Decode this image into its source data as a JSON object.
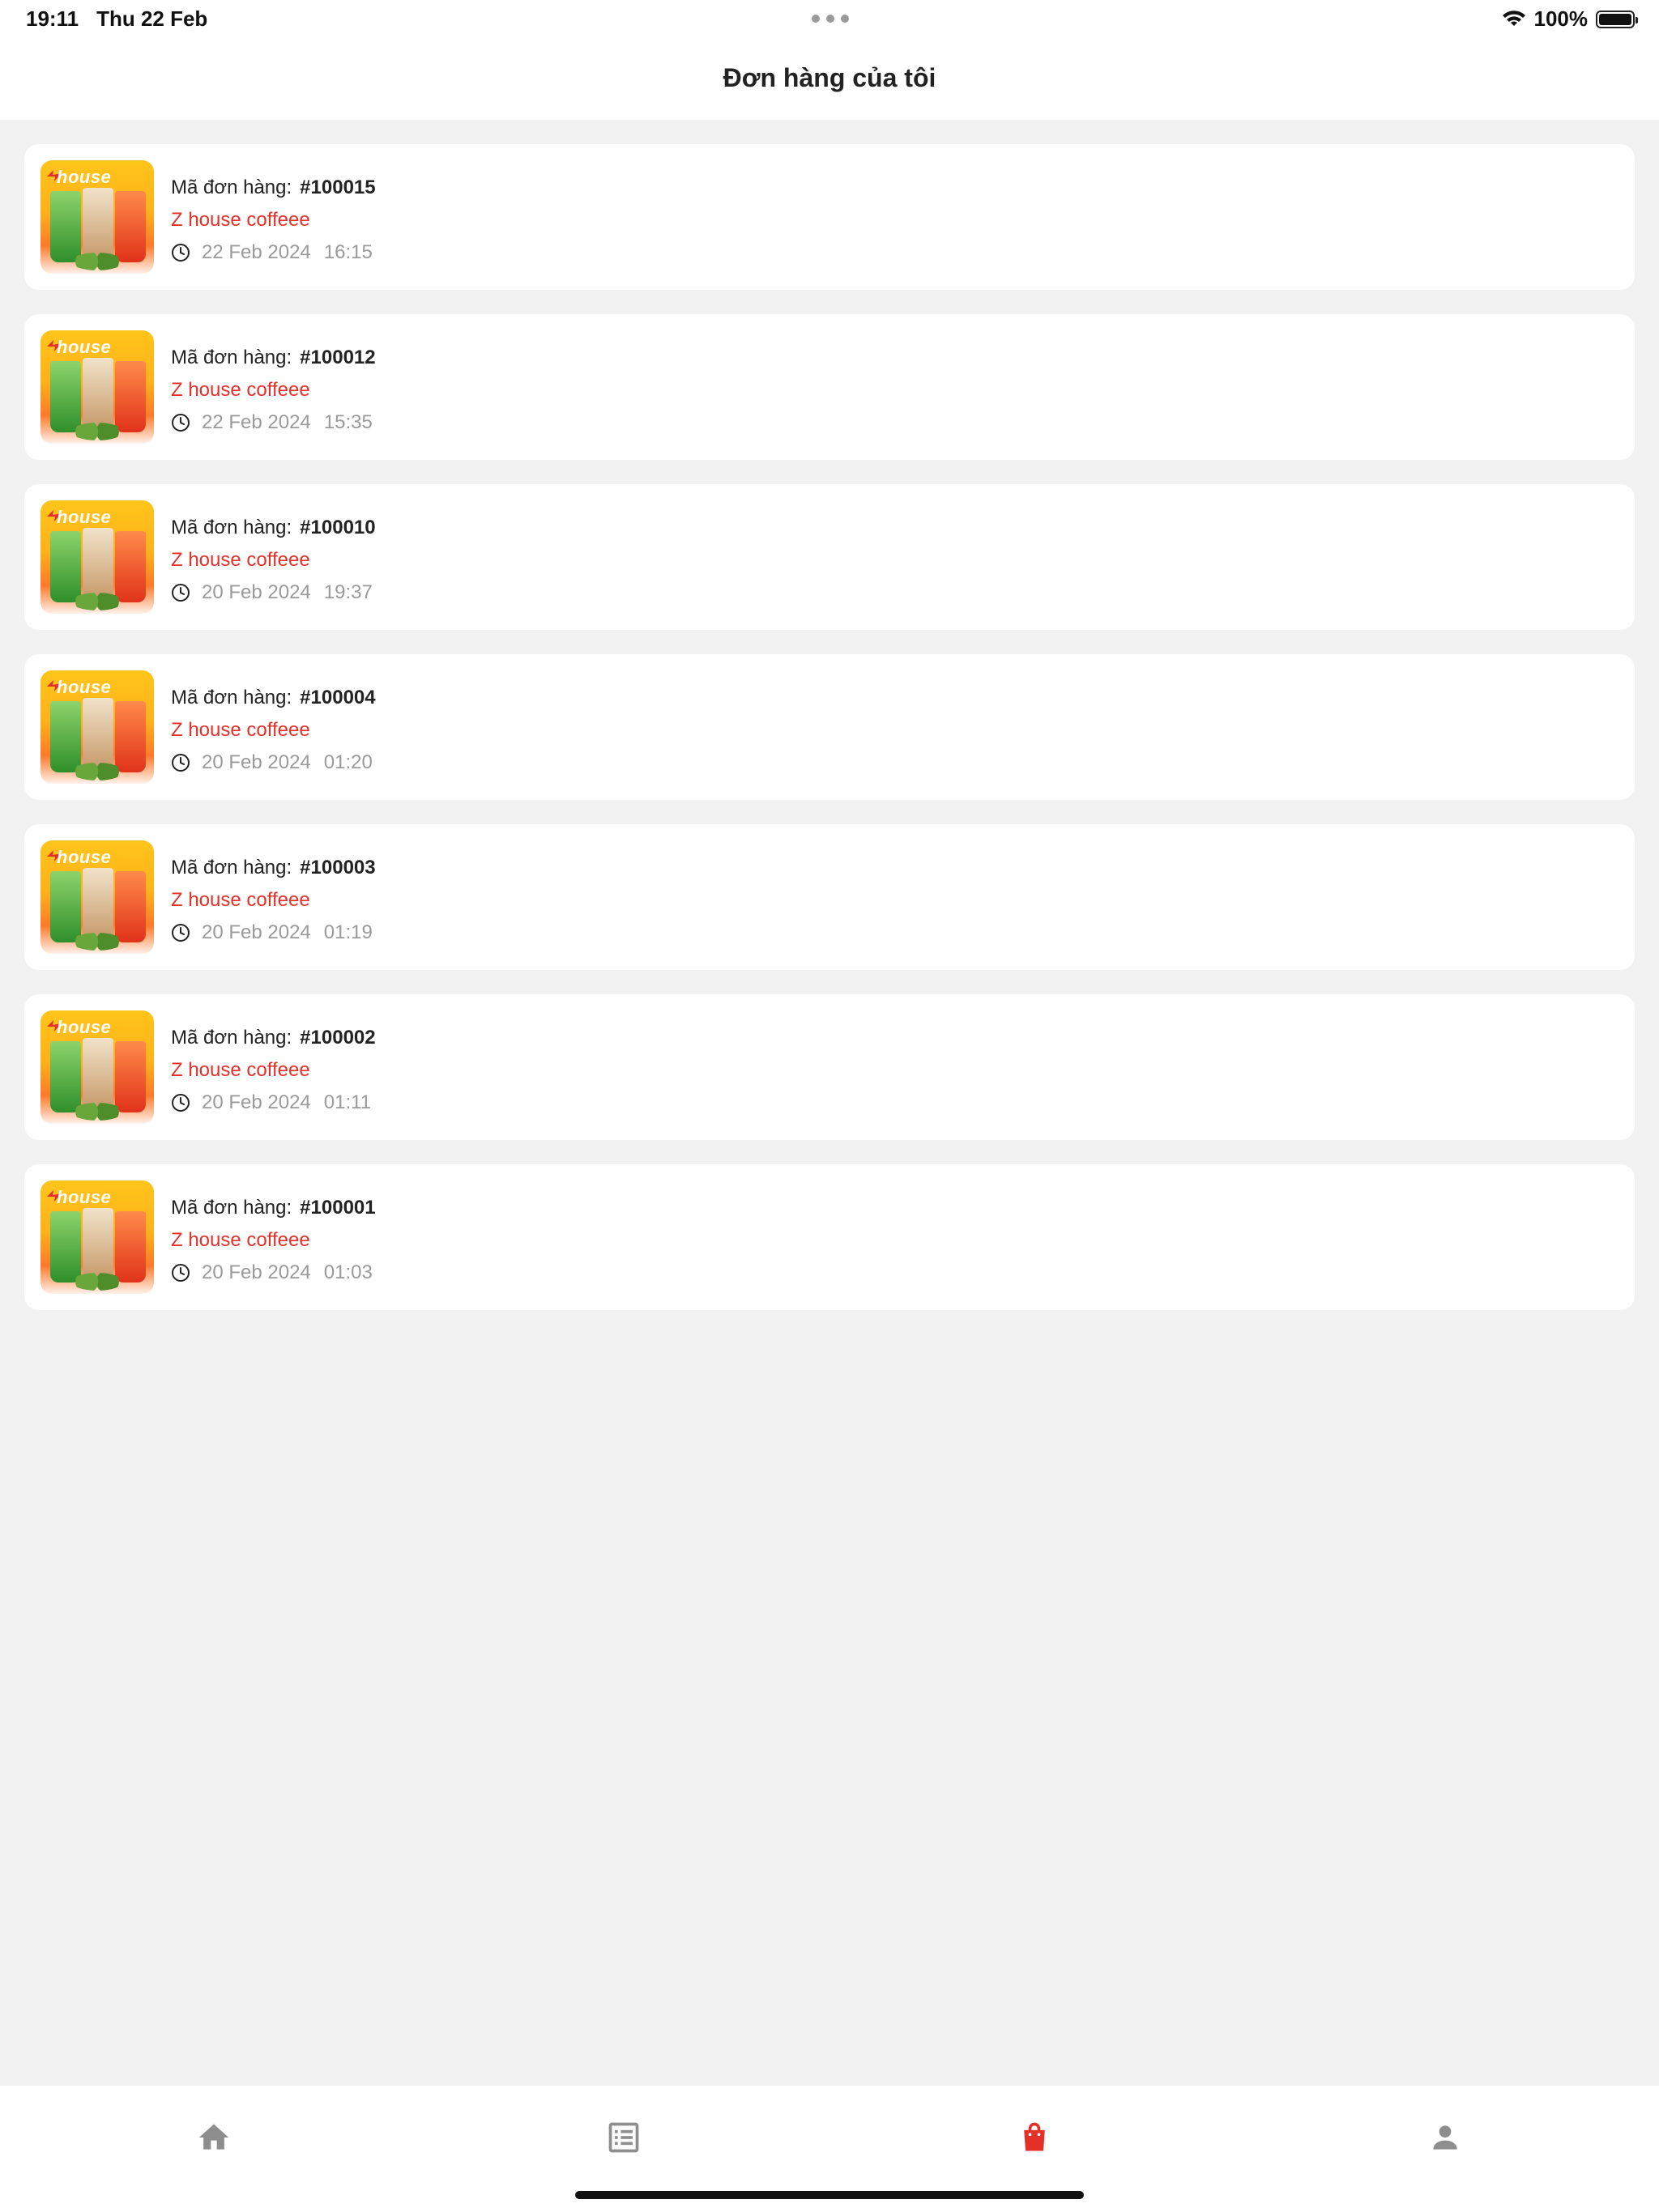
{
  "status_bar": {
    "time": "19:11",
    "date": "Thu 22 Feb",
    "battery": "100%"
  },
  "header": {
    "title": "Đơn hàng của tôi"
  },
  "orders": [
    {
      "label": "Mã đơn hàng:",
      "code": "#100015",
      "store": "Z house coffeee",
      "date": "22 Feb 2024",
      "time": "16:15"
    },
    {
      "label": "Mã đơn hàng:",
      "code": "#100012",
      "store": "Z house coffeee",
      "date": "22 Feb 2024",
      "time": "15:35"
    },
    {
      "label": "Mã đơn hàng:",
      "code": "#100010",
      "store": "Z house coffeee",
      "date": "20 Feb 2024",
      "time": "19:37"
    },
    {
      "label": "Mã đơn hàng:",
      "code": "#100004",
      "store": "Z house coffeee",
      "date": "20 Feb 2024",
      "time": "01:20"
    },
    {
      "label": "Mã đơn hàng:",
      "code": "#100003",
      "store": "Z house coffeee",
      "date": "20 Feb 2024",
      "time": "01:19"
    },
    {
      "label": "Mã đơn hàng:",
      "code": "#100002",
      "store": "Z house coffeee",
      "date": "20 Feb 2024",
      "time": "01:11"
    },
    {
      "label": "Mã đơn hàng:",
      "code": "#100001",
      "store": "Z house coffeee",
      "date": "20 Feb 2024",
      "time": "01:03"
    }
  ],
  "thumbnail": {
    "brand_text": "house"
  },
  "tabs": [
    {
      "name": "home",
      "icon": "home-icon",
      "active": false
    },
    {
      "name": "menu",
      "icon": "list-icon",
      "active": false
    },
    {
      "name": "orders",
      "icon": "shopping-bag-icon",
      "active": true
    },
    {
      "name": "account",
      "icon": "person-icon",
      "active": false
    }
  ],
  "colors": {
    "accent": "#e3312a",
    "inactive_icon": "#8e8e8e",
    "background": "#f2f2f2"
  }
}
